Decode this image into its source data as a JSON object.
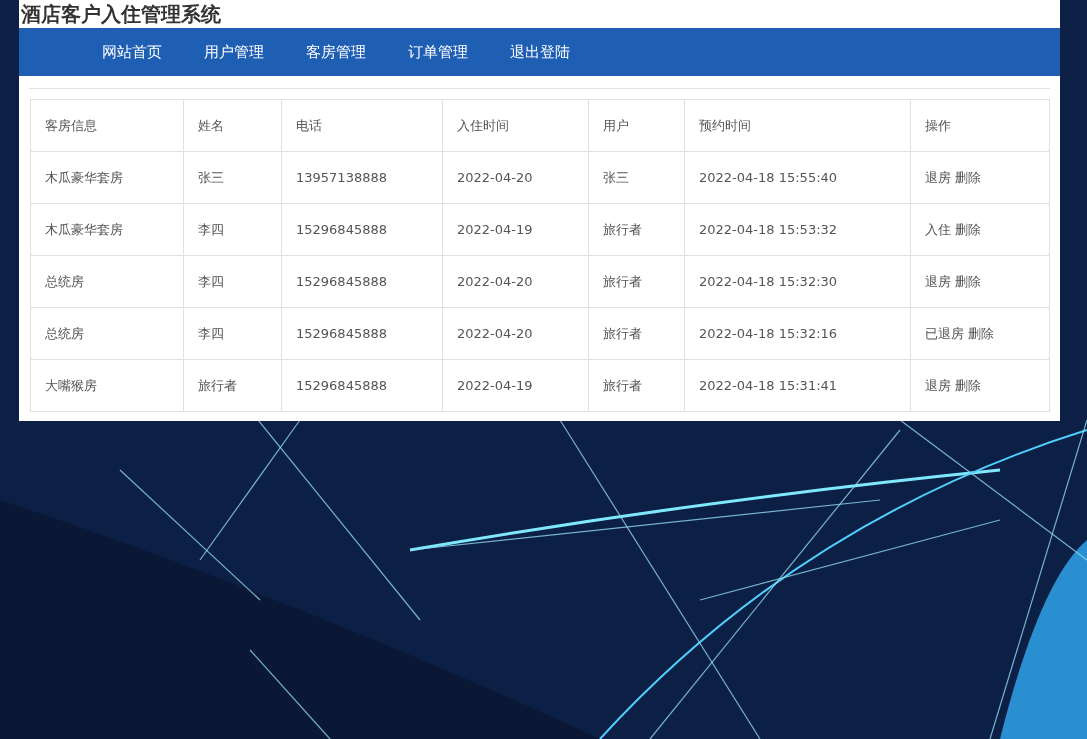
{
  "header": {
    "title": "酒店客户入住管理系统"
  },
  "nav": {
    "items": [
      "网站首页",
      "用户管理",
      "客房管理",
      "订单管理",
      "退出登陆"
    ]
  },
  "table": {
    "columns": [
      "客房信息",
      "姓名",
      "电话",
      "入住时间",
      "用户",
      "预约时间",
      "操作"
    ],
    "rows": [
      {
        "cells": [
          "木瓜豪华套房",
          "张三",
          "13957138888",
          "2022-04-20",
          "张三",
          "2022-04-18 15:55:40"
        ],
        "actions": [
          "退房",
          "删除"
        ]
      },
      {
        "cells": [
          "木瓜豪华套房",
          "李四",
          "15296845888",
          "2022-04-19",
          "旅行者",
          "2022-04-18 15:53:32"
        ],
        "actions": [
          "入住",
          "删除"
        ]
      },
      {
        "cells": [
          "总统房",
          "李四",
          "15296845888",
          "2022-04-20",
          "旅行者",
          "2022-04-18 15:32:30"
        ],
        "actions": [
          "退房",
          "删除"
        ]
      },
      {
        "cells": [
          "总统房",
          "李四",
          "15296845888",
          "2022-04-20",
          "旅行者",
          "2022-04-18 15:32:16"
        ],
        "actions": [
          "已退房",
          "删除"
        ]
      },
      {
        "cells": [
          "大嘴猴房",
          "旅行者",
          "15296845888",
          "2022-04-19",
          "旅行者",
          "2022-04-18 15:31:41"
        ],
        "actions": [
          "退房",
          "删除"
        ]
      }
    ]
  }
}
